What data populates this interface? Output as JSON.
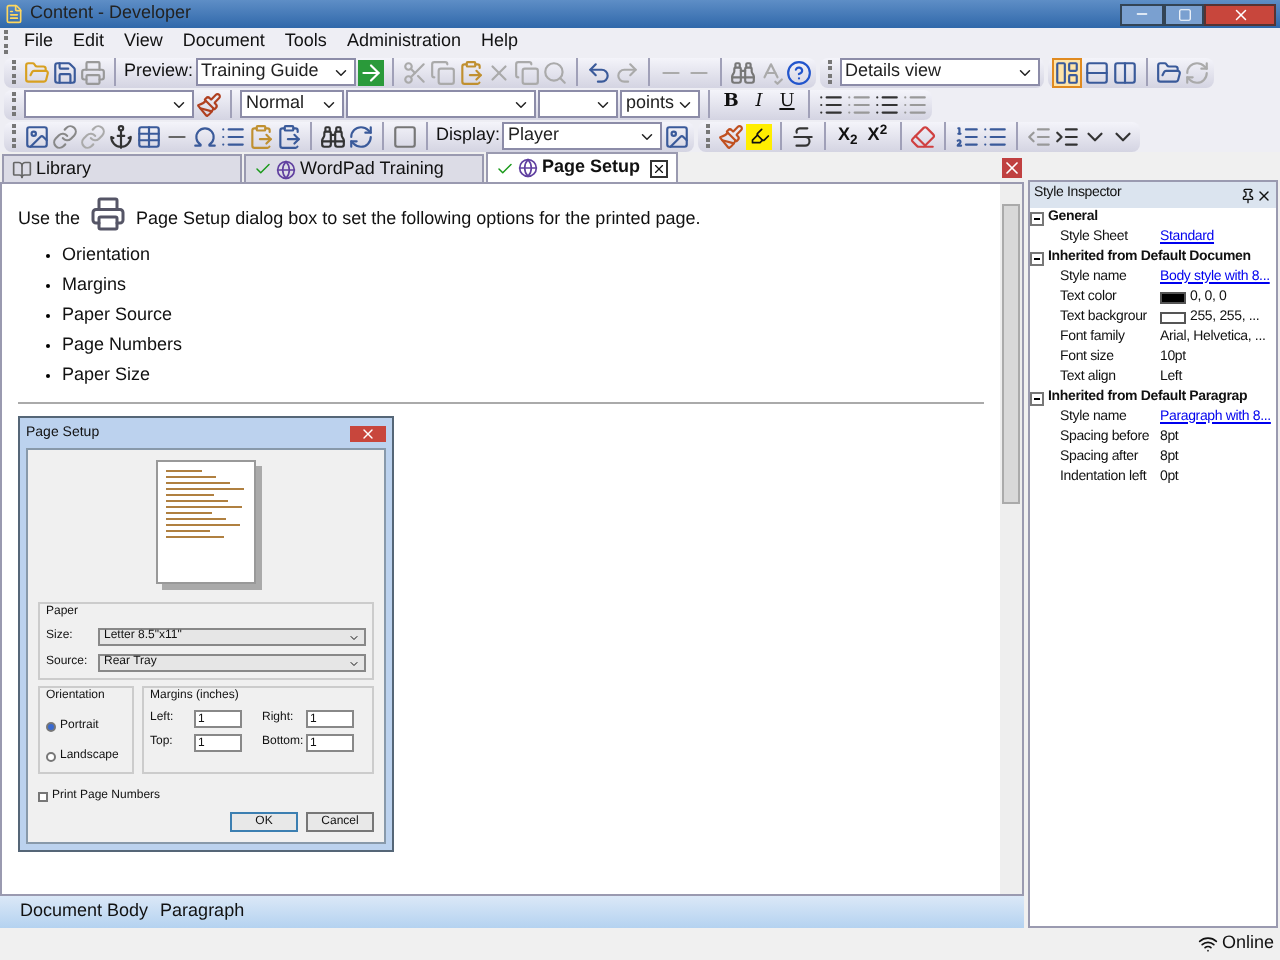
{
  "window": {
    "title": "Content - Developer"
  },
  "menu": [
    "File",
    "Edit",
    "View",
    "Document",
    "Tools",
    "Administration",
    "Help"
  ],
  "toolbar": {
    "preview_label": "Preview:",
    "preview_value": "Training Guide",
    "view_value": "Details view",
    "style_value": "Normal",
    "units_value": "points",
    "format_buttons": [
      "B",
      "I",
      "U"
    ],
    "script_buttons": [
      "X$_{2}$",
      "X$^{2}$"
    ],
    "display_label": "Display:",
    "display_value": "Player"
  },
  "tabs": [
    {
      "label": "Library",
      "selected": false,
      "checked": false
    },
    {
      "label": "WordPad Training",
      "selected": false,
      "checked": true
    },
    {
      "label": "Page Setup",
      "selected": true,
      "checked": true
    }
  ],
  "document": {
    "intro_before": "Use the",
    "intro_after": "Page Setup dialog box to set the following options for the printed page.",
    "bullets": [
      "Orientation",
      "Margins",
      "Paper Source",
      "Page Numbers",
      "Paper Size"
    ],
    "dialog": {
      "title": "Page Setup",
      "paper_group": "Paper",
      "size_label": "Size:",
      "size_value": "Letter 8.5\"x11\"",
      "source_label": "Source:",
      "source_value": "Rear Tray",
      "orientation_group": "Orientation",
      "radios": [
        {
          "label": "Portrait",
          "selected": true
        },
        {
          "label": "Landscape",
          "selected": false
        }
      ],
      "margins_group": "Margins (inches)",
      "margins": [
        {
          "label": "Left:",
          "value": "1"
        },
        {
          "label": "Right:",
          "value": "1"
        },
        {
          "label": "Top:",
          "value": "1"
        },
        {
          "label": "Bottom:",
          "value": "1"
        }
      ],
      "checkbox": {
        "label": "Print Page Numbers",
        "checked": false
      },
      "buttons": [
        "OK",
        "Cancel"
      ]
    }
  },
  "breadcrumb": [
    "Document Body",
    "Paragraph"
  ],
  "inspector": {
    "title": "Style Inspector",
    "sections": [
      {
        "title": "General",
        "expanded": true,
        "rows": [
          {
            "kind": "link",
            "label": "Style Sheet",
            "value": "Standard"
          }
        ]
      },
      {
        "title": "Inherited from Default Documen",
        "expanded": true,
        "rows": [
          {
            "kind": "link",
            "label": "Style name",
            "value": "Body style with 8..."
          },
          {
            "kind": "swatch",
            "label": "Text color",
            "value": "0, 0, 0",
            "color": "#000000"
          },
          {
            "kind": "swatch",
            "label": "Text backgrour",
            "value": "255, 255, ...",
            "color": "#ffffff"
          },
          {
            "kind": "text",
            "label": "Font family",
            "value": "Arial, Helvetica, ..."
          },
          {
            "kind": "text",
            "label": "Font size",
            "value": "10pt"
          },
          {
            "kind": "text",
            "label": "Text align",
            "value": "Left"
          }
        ]
      },
      {
        "title": "Inherited from Default Paragrap",
        "expanded": true,
        "rows": [
          {
            "kind": "link",
            "label": "Style name",
            "value": "Paragraph with 8..."
          },
          {
            "kind": "text",
            "label": "Spacing before",
            "value": "8pt"
          },
          {
            "kind": "text",
            "label": "Spacing after",
            "value": "8pt"
          },
          {
            "kind": "text",
            "label": "Indentation left",
            "value": "0pt"
          }
        ]
      }
    ]
  },
  "status": {
    "text": "Online"
  }
}
